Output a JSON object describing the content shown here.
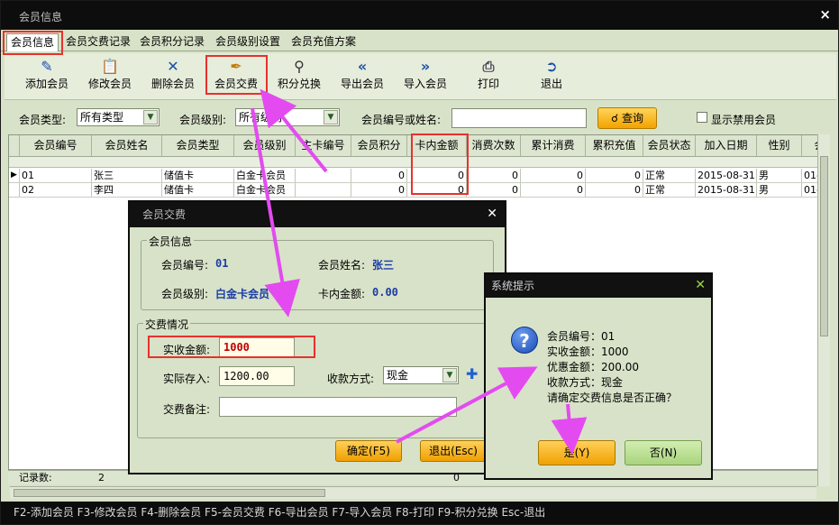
{
  "window": {
    "title": "会员信息",
    "close": "×"
  },
  "tabs": [
    {
      "label": "会员信息"
    },
    {
      "label": "会员交费记录"
    },
    {
      "label": "会员积分记录"
    },
    {
      "label": "会员级别设置"
    },
    {
      "label": "会员充值方案"
    }
  ],
  "toolbar": {
    "add": "添加会员",
    "edit": "修改会员",
    "delete": "删除会员",
    "pay": "会员交费",
    "points": "积分兑换",
    "export": "导出会员",
    "import": "导入会员",
    "print": "打印",
    "exit": "退出"
  },
  "filter": {
    "type_label": "会员类型:",
    "type_value": "所有类型",
    "level_label": "会员级别:",
    "level_value": "所有级别",
    "search_label": "会员编号或姓名:",
    "search_value": "",
    "query_button": "查询",
    "show_disabled": "显示禁用会员"
  },
  "grid": {
    "columns": [
      "会员编号",
      "会员姓名",
      "会员类型",
      "会员级别",
      "主卡编号",
      "会员积分",
      "卡内金额",
      "消费次数",
      "累计消费",
      "累积充值",
      "会员状态",
      "加入日期",
      "性别",
      "会"
    ],
    "rows": [
      [
        "01",
        "张三",
        "储值卡",
        "白金卡会员",
        "",
        "0",
        "0",
        "0",
        "0",
        "0",
        "正常",
        "2015-08-31",
        "男",
        "01-"
      ],
      [
        "02",
        "李四",
        "储值卡",
        "白金卡会员",
        "",
        "0",
        "0",
        "0",
        "0",
        "0",
        "正常",
        "2015-08-31",
        "男",
        "01-"
      ]
    ],
    "total_label": "记录数:",
    "total_value": "2",
    "total_amount": "0"
  },
  "statusbar": "F2-添加会员 F3-修改会员 F4-删除会员 F5-会员交费 F6-导出会员 F7-导入会员 F8-打印 F9-积分兑换 Esc-退出",
  "pay_dialog": {
    "title": "会员交费",
    "member_group": "会员信息",
    "id_label": "会员编号:",
    "id_value": "01",
    "name_label": "会员姓名:",
    "name_value": "张三",
    "level_label": "会员级别:",
    "level_value": "白金卡会员",
    "balance_label": "卡内金额:",
    "balance_value": "0.00",
    "pay_group": "交费情况",
    "received_label": "实收金额:",
    "received_value": "1000",
    "deposit_label": "实际存入:",
    "deposit_value": "1200.00",
    "method_label": "收款方式:",
    "method_value": "现金",
    "remark_label": "交费备注:",
    "remark_value": "",
    "ok": "确定(F5)",
    "cancel": "退出(Esc)"
  },
  "confirm_dialog": {
    "title": "系统提示",
    "lines": [
      "会员编号：01",
      "实收金额：1000",
      "优惠金额：200.00",
      "收款方式：现金",
      "请确定交费信息是否正确？"
    ],
    "yes": "是(Y)",
    "no": "否(N)"
  },
  "colors": {
    "highlight": "#e8312e",
    "arrow": "#e34bf0",
    "accent": "#f2a300"
  }
}
